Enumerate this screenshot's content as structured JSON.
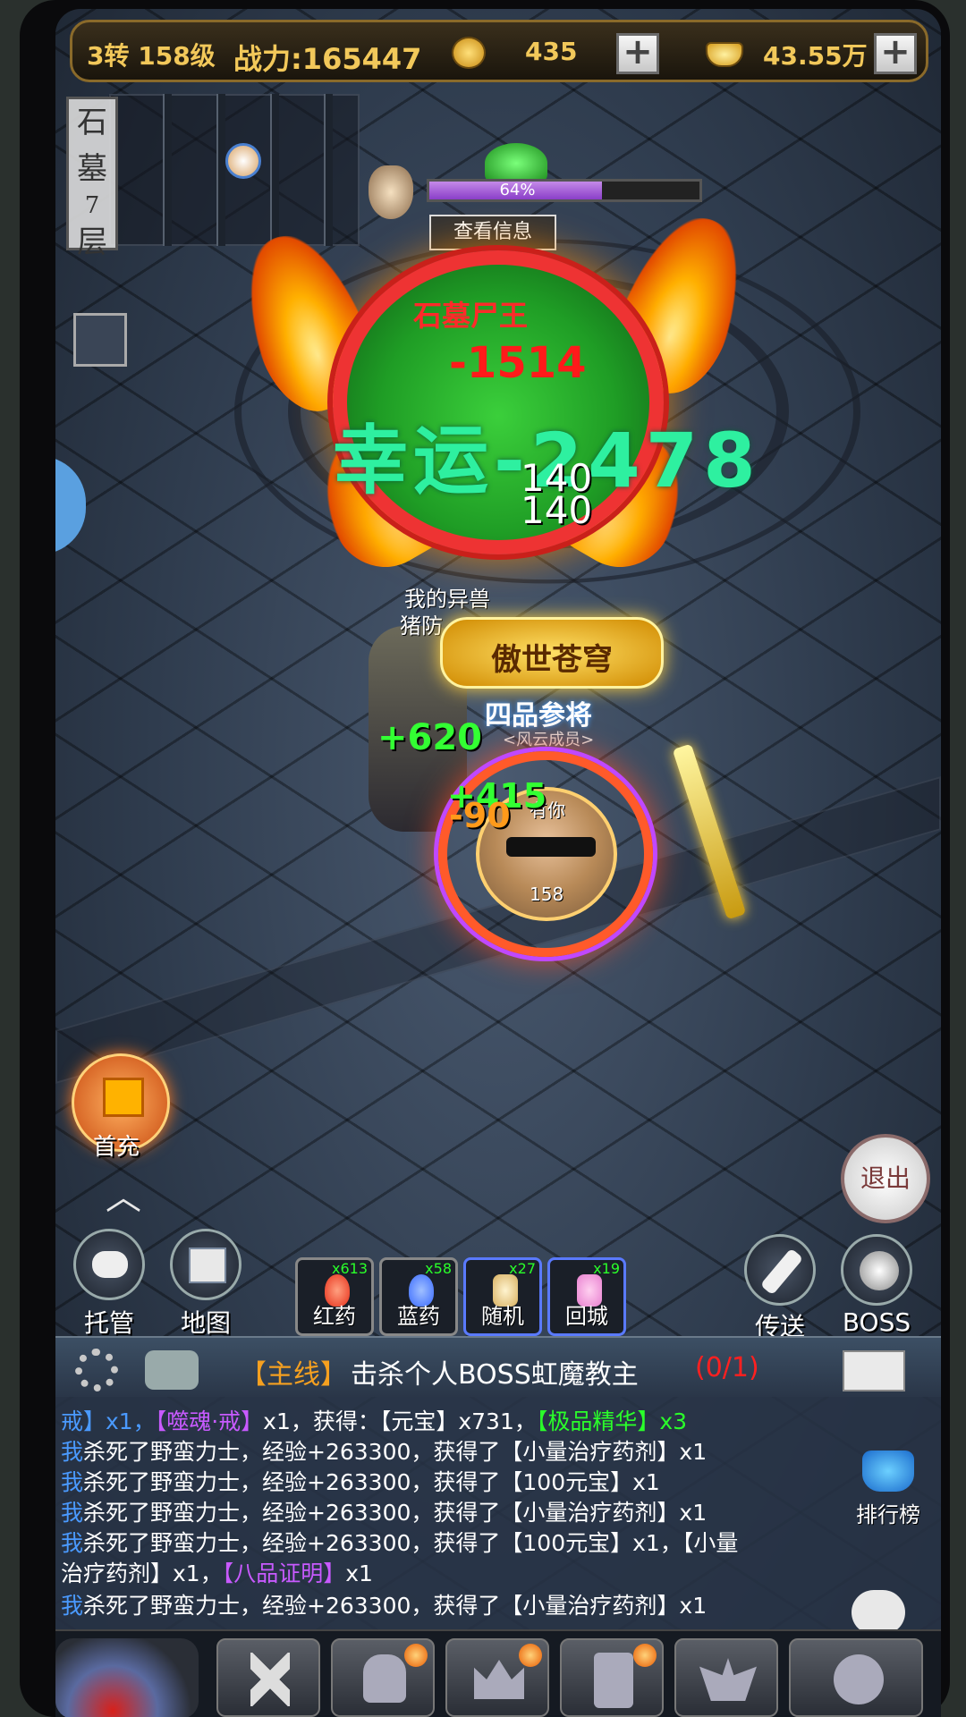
{
  "topbar": {
    "level": "3转 158级",
    "power": "战力:165447",
    "coins": "435",
    "ingots": "43.55万",
    "plus": "+"
  },
  "map": {
    "name_line1": "石",
    "name_line2": "墓",
    "name_line3": "7",
    "name_line4": "层"
  },
  "boss": {
    "hp_percent": "64%",
    "hp_fraction": 0.64,
    "view_info": "查看信息",
    "name": "石墓尸王",
    "damage": "-1514",
    "lucky_damage": "幸运-2478",
    "hp_a": "140",
    "hp_b": "140"
  },
  "pet": {
    "label1": "我的异兽",
    "label2": "猪防"
  },
  "player": {
    "title": "傲世苍穹",
    "rank": "四品参将",
    "guild": "<风云成员>",
    "name_fragment": "有你",
    "level": "158",
    "heal1": "+620",
    "heal2": "+415",
    "damage": "-90"
  },
  "gift": {
    "label": "首充",
    "arrow": "︿"
  },
  "exit": {
    "label": "退出"
  },
  "buttons": {
    "auto": "托管",
    "map": "地图",
    "teleport": "传送",
    "boss": "BOSS"
  },
  "potions": [
    {
      "label": "红药",
      "count": "x613",
      "color": "#e8301a"
    },
    {
      "label": "蓝药",
      "count": "x58",
      "color": "#3a6aff"
    },
    {
      "label": "随机",
      "count": "x27",
      "color": "#e8d090"
    },
    {
      "label": "回城",
      "count": "x19",
      "color": "#e880d0"
    }
  ],
  "quest": {
    "tag": "【主线】",
    "text": "击杀个人BOSS虹魔教主",
    "progress": "(0/1)"
  },
  "chat": {
    "line1_a": "戒】x1，",
    "line1_b": "【噬魂·戒】",
    "line1_c": "x1，获得：【元宝】x731，",
    "line1_d": "【极品精华】",
    "line1_e": "x3",
    "me": "我",
    "line2": "杀死了野蛮力士，经验+263300，获得了【小量治疗药剂】x1",
    "line3": "杀死了野蛮力士，经验+263300，获得了【100元宝】x1",
    "line4": "杀死了野蛮力士，经验+263300，获得了【小量治疗药剂】x1",
    "line5": "杀死了野蛮力士，经验+263300，获得了【100元宝】x1，【小量",
    "line6_a": "治疗药剂】x1，",
    "line6_b": "【八品证明】",
    "line6_c": "x1",
    "line7": "杀死了野蛮力士，经验+263300，获得了【小量治疗药剂】x1"
  },
  "rank_button": {
    "label": "排行榜"
  }
}
